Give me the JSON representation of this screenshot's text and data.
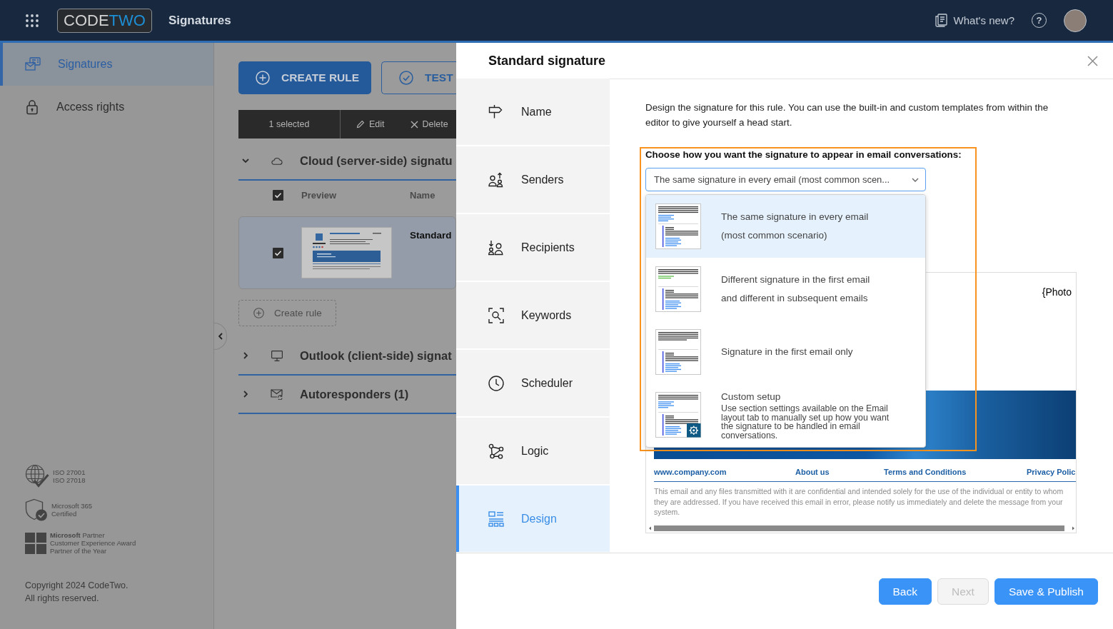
{
  "top_bar": {
    "logo": [
      "CODE",
      "TWO"
    ],
    "app_name": "Signatures",
    "whats_new": "What's new?",
    "help": "?"
  },
  "sidebar": {
    "items": [
      {
        "label": "Signatures",
        "selected": true
      },
      {
        "label": "Access rights",
        "selected": false
      }
    ],
    "certifications": [
      {
        "kind": "iso",
        "lines": [
          "ISO 27001",
          "ISO 27018"
        ]
      },
      {
        "kind": "certified",
        "lines": [
          "Microsoft 365",
          "Certified"
        ]
      },
      {
        "kind": "partner",
        "lines": [
          "**Microsoft** Partner",
          "Customer Experience Award",
          "Partner of the Year"
        ]
      }
    ],
    "copyright": [
      "Copyright 2024 CodeTwo.",
      "All rights reserved."
    ]
  },
  "main": {
    "buttons": [
      {
        "label": "CREATE RULE",
        "kind": "primary"
      },
      {
        "label": "TEST",
        "kind": "outline"
      }
    ],
    "toolbar": {
      "selection": "1 selected",
      "actions": [
        {
          "label": "Edit",
          "kind": "edit"
        },
        {
          "label": "Delete",
          "kind": "delete"
        }
      ]
    },
    "sections": [
      {
        "title": "Cloud (server-side) signatu",
        "kind": "cloud",
        "expanded": true,
        "table": {
          "all_checked": true,
          "columns": [
            "Preview",
            "Name"
          ],
          "rows": [
            {
              "name": "Standard",
              "selected": true,
              "checked": true
            }
          ]
        },
        "create_rule": "Create rule"
      },
      {
        "title": "Outlook (client-side) signat",
        "kind": "desktop",
        "expanded": false
      },
      {
        "title": "Autoresponders (1)",
        "kind": "autoresponder",
        "expanded": false
      }
    ]
  },
  "panel": {
    "title": "Standard signature",
    "steps": [
      {
        "label": "Name",
        "selected": false
      },
      {
        "label": "Senders",
        "selected": false
      },
      {
        "label": "Recipients",
        "selected": false
      },
      {
        "label": "Keywords",
        "selected": false
      },
      {
        "label": "Scheduler",
        "selected": false
      },
      {
        "label": "Logic",
        "selected": false
      },
      {
        "label": "Design",
        "selected": true
      }
    ],
    "description": "Design the signature for this rule. You can use the built-in and custom templates from within the editor to give yourself a head start.",
    "conversation_setting": {
      "label": "Choose how you want the signature to appear in email conversations:",
      "value": "The same signature in every email (most common scen...",
      "expanded": true,
      "options": [
        {
          "kind": "same",
          "lines": [
            "The same signature in every email",
            "(most common scenario)"
          ],
          "selected": true
        },
        {
          "kind": "different",
          "lines": [
            "Different signature in the first email",
            "and different in subsequent emails"
          ],
          "selected": false
        },
        {
          "kind": "first_only",
          "lines": [
            "Signature in the first email only"
          ],
          "selected": false
        },
        {
          "kind": "custom",
          "lines": [
            "Custom setup"
          ],
          "description": "Use section settings available on the Email layout tab to manually set up how you want the signature to be handled in email conversations.",
          "selected": false
        }
      ]
    },
    "preview": {
      "photo": "{Photo",
      "links": [
        "www.company.com",
        "About us",
        "Terms and Conditions",
        "Privacy Polic"
      ],
      "disclaimer": "This email and any files transmitted with it are confidential and intended solely for the use of the individual or entity to whom they are addressed. If you have received this email in error, please notify us immediately and delete the message from your system."
    },
    "buttons": [
      {
        "label": "Back",
        "disabled": false
      },
      {
        "label": "Next",
        "disabled": true
      },
      {
        "label": "Save & Publish",
        "disabled": false
      }
    ]
  }
}
